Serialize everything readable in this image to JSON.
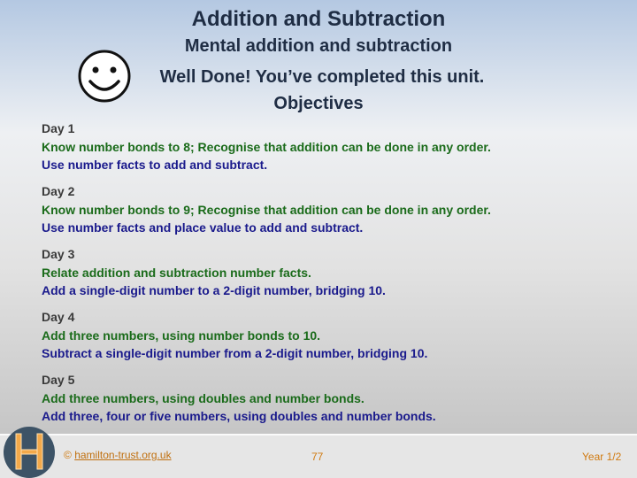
{
  "header": {
    "title": "Addition and Subtraction",
    "subtitle": "Mental addition and subtraction",
    "message": "Well Done!  You’ve completed this unit.",
    "objectives_heading": "Objectives"
  },
  "icons": {
    "smiley": "smiley-face-icon",
    "logo": "hamilton-h-logo"
  },
  "days": [
    {
      "label": "Day 1",
      "line1": "Know number bonds to 8; Recognise that addition can be done in any order.",
      "line2": "Use number facts to add and subtract."
    },
    {
      "label": "Day 2",
      "line1": "Know number bonds to 9; Recognise that addition can be done in any order.",
      "line2": "Use number facts and place value to add and subtract."
    },
    {
      "label": "Day 3",
      "line1": "Relate addition and subtraction number facts.",
      "line2": "Add a single-digit number to a 2-digit number, bridging 10."
    },
    {
      "label": "Day 4",
      "line1": "Add three numbers, using number bonds to 10.",
      "line2": "Subtract a single-digit number from a 2-digit number, bridging 10."
    },
    {
      "label": "Day 5",
      "line1": "Add three numbers, using doubles and number bonds.",
      "line2": "Add three, four or five numbers, using doubles and number bonds."
    }
  ],
  "footer": {
    "copyright_symbol": "©",
    "link": "hamilton-trust.org.uk",
    "page": "77",
    "year": "Year 1/2"
  },
  "colors": {
    "heading": "#1f2d44",
    "objective_primary": "#1a6b1a",
    "objective_secondary": "#1a1a8c",
    "footer_text": "#d07a10",
    "logo_bg": "#3d5366"
  }
}
